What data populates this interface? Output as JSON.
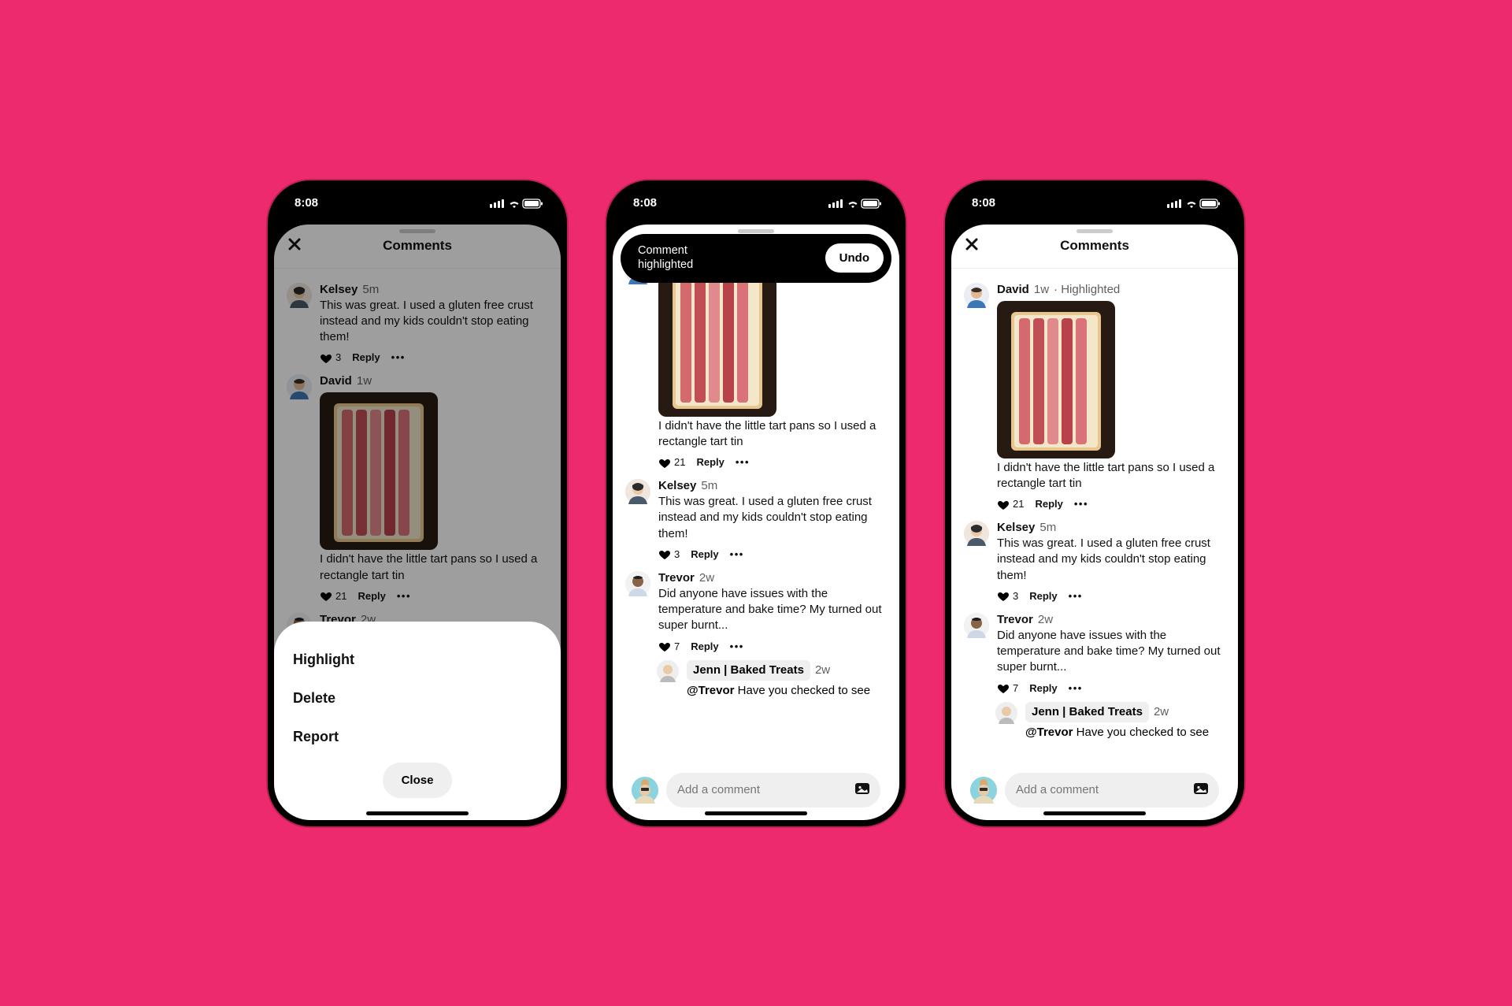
{
  "status": {
    "time": "8:08"
  },
  "header": {
    "title": "Comments"
  },
  "toast": {
    "text_line1": "Comment",
    "text_line2": "highlighted",
    "button": "Undo"
  },
  "sheet": {
    "items": [
      "Highlight",
      "Delete",
      "Report"
    ],
    "close": "Close"
  },
  "input": {
    "placeholder": "Add a comment"
  },
  "comments": {
    "kelsey": {
      "name": "Kelsey",
      "time": "5m",
      "text": "This was great. I used a gluten free crust instead and my kids couldn't stop eating them!",
      "likes": "3",
      "reply": "Reply"
    },
    "david": {
      "name": "David",
      "time": "1w",
      "highlighted_suffix": " · Highlighted",
      "text": "I didn't have the little tart pans so I used a rectangle tart tin",
      "likes": "21",
      "reply": "Reply"
    },
    "trevor": {
      "name": "Trevor",
      "time": "2w",
      "text": "Did anyone have issues with the temperature and bake time? My turned out super burnt...",
      "text_cut": "Did anyone have issues with the",
      "likes": "7",
      "reply": "Reply"
    },
    "jenn": {
      "name": "Jenn | Baked Treats",
      "time": "2w",
      "mention": "@Trevor",
      "text": " Have you checked to see"
    }
  }
}
